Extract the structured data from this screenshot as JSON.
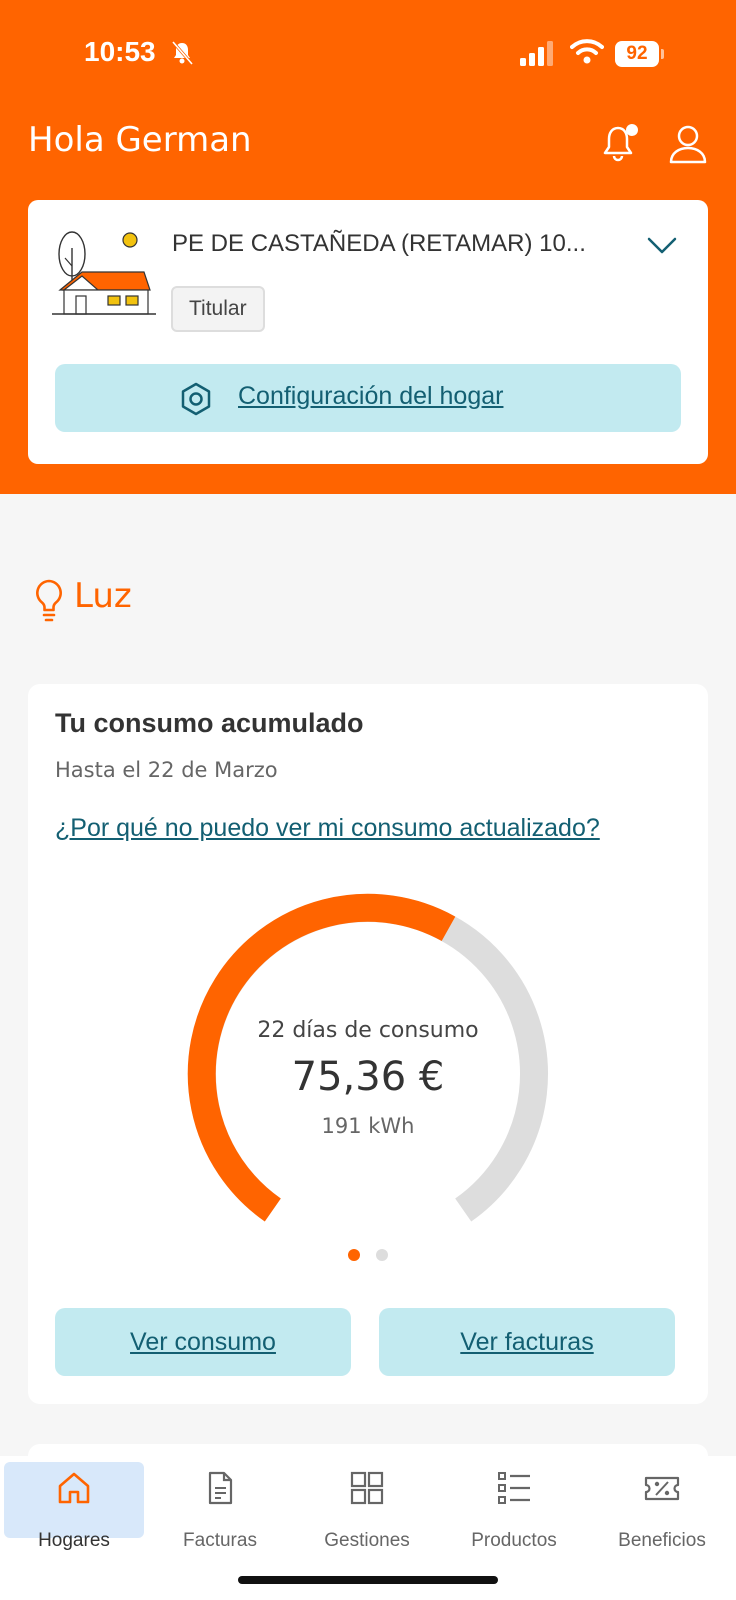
{
  "status_bar": {
    "time": "10:53",
    "battery": "92"
  },
  "header": {
    "greeting": "Hola German"
  },
  "home_card": {
    "address": "PE  DE CASTAÑEDA (RETAMAR) 10...",
    "role_badge": "Titular",
    "config_label": "Configuración del hogar"
  },
  "section": {
    "title": "Luz"
  },
  "consumo": {
    "title": "Tu consumo acumulado",
    "subtitle": "Hasta el 22 de Marzo",
    "info_link": "¿Por qué no puedo ver mi consumo actualizado?",
    "days_label": "22 días de consumo",
    "amount": "75,36 €",
    "energy": "191 kWh",
    "progress_fraction": 0.6,
    "pager": {
      "pages": 2,
      "active": 1
    },
    "btn_consumo": "Ver consumo",
    "btn_facturas": "Ver facturas"
  },
  "nav": {
    "items": [
      {
        "label": "Hogares",
        "icon": "home-icon",
        "active": true
      },
      {
        "label": "Facturas",
        "icon": "invoice-icon",
        "active": false
      },
      {
        "label": "Gestiones",
        "icon": "grid-icon",
        "active": false
      },
      {
        "label": "Productos",
        "icon": "list-icon",
        "active": false
      },
      {
        "label": "Beneficios",
        "icon": "discount-icon",
        "active": false
      }
    ]
  },
  "colors": {
    "brand": "#ff6400",
    "button_bg": "#c2eaf0",
    "link": "#135f72",
    "nav_active_bg": "#d8e8fa",
    "gauge_track": "#dddddd"
  }
}
